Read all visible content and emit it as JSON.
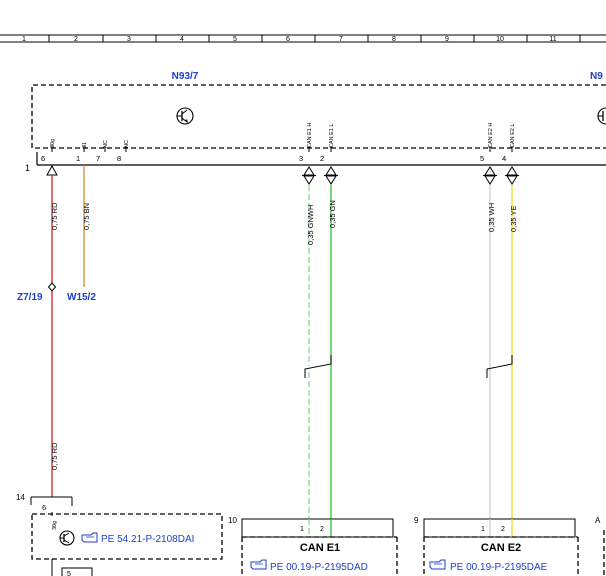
{
  "grid_columns": [
    "1",
    "2",
    "3",
    "4",
    "5",
    "6",
    "7",
    "8",
    "9",
    "10",
    "11"
  ],
  "components": {
    "main_module": "N93/7",
    "right_module_partial": "N9",
    "ground_connector": "Z7/19",
    "ground_point": "W15/2"
  },
  "connector": {
    "number": "1",
    "pin_numbers": [
      "6",
      "1",
      "7",
      "8",
      "3",
      "2",
      "5",
      "4"
    ],
    "pin_names": [
      "30g",
      "31",
      "NC",
      "NC",
      "CAN E1 H",
      "CAN E1 L",
      "CAN E2 H",
      "CAN E2 L"
    ]
  },
  "wires": [
    {
      "label": "0,75 RD",
      "color": "#d42020"
    },
    {
      "label": "0,75 BN",
      "color": "#d9892b"
    },
    {
      "label": "0,35 GNWH",
      "color": "#8fd88f"
    },
    {
      "label": "0,35 GN",
      "color": "#2ec42e"
    },
    {
      "label": "0,35 WH",
      "color": "#cfcfcf"
    },
    {
      "label": "0,35 YE",
      "color": "#eedd22"
    },
    {
      "label": "0,75 RD",
      "color": "#d42020"
    }
  ],
  "bottom": {
    "left_conn_number": "14",
    "left_pin": "6",
    "left_pin_name": "30g",
    "left_ref": "PE 54.21-P-2108DAI",
    "left_small_number": "5",
    "bus1_conn_number": "10",
    "bus1_name": "CAN E1",
    "bus1_ref": "PE 00.19-P-2195DAD",
    "bus1_pins": [
      "1",
      "2"
    ],
    "bus2_conn_number": "9",
    "bus2_name": "CAN E2",
    "bus2_ref": "PE 00.19-P-2195DAE",
    "bus2_pins": [
      "1",
      "2"
    ],
    "right_letter": "A"
  },
  "reference_icon": "pointing-hand-icon",
  "transistor_icon": "transistor-icon"
}
